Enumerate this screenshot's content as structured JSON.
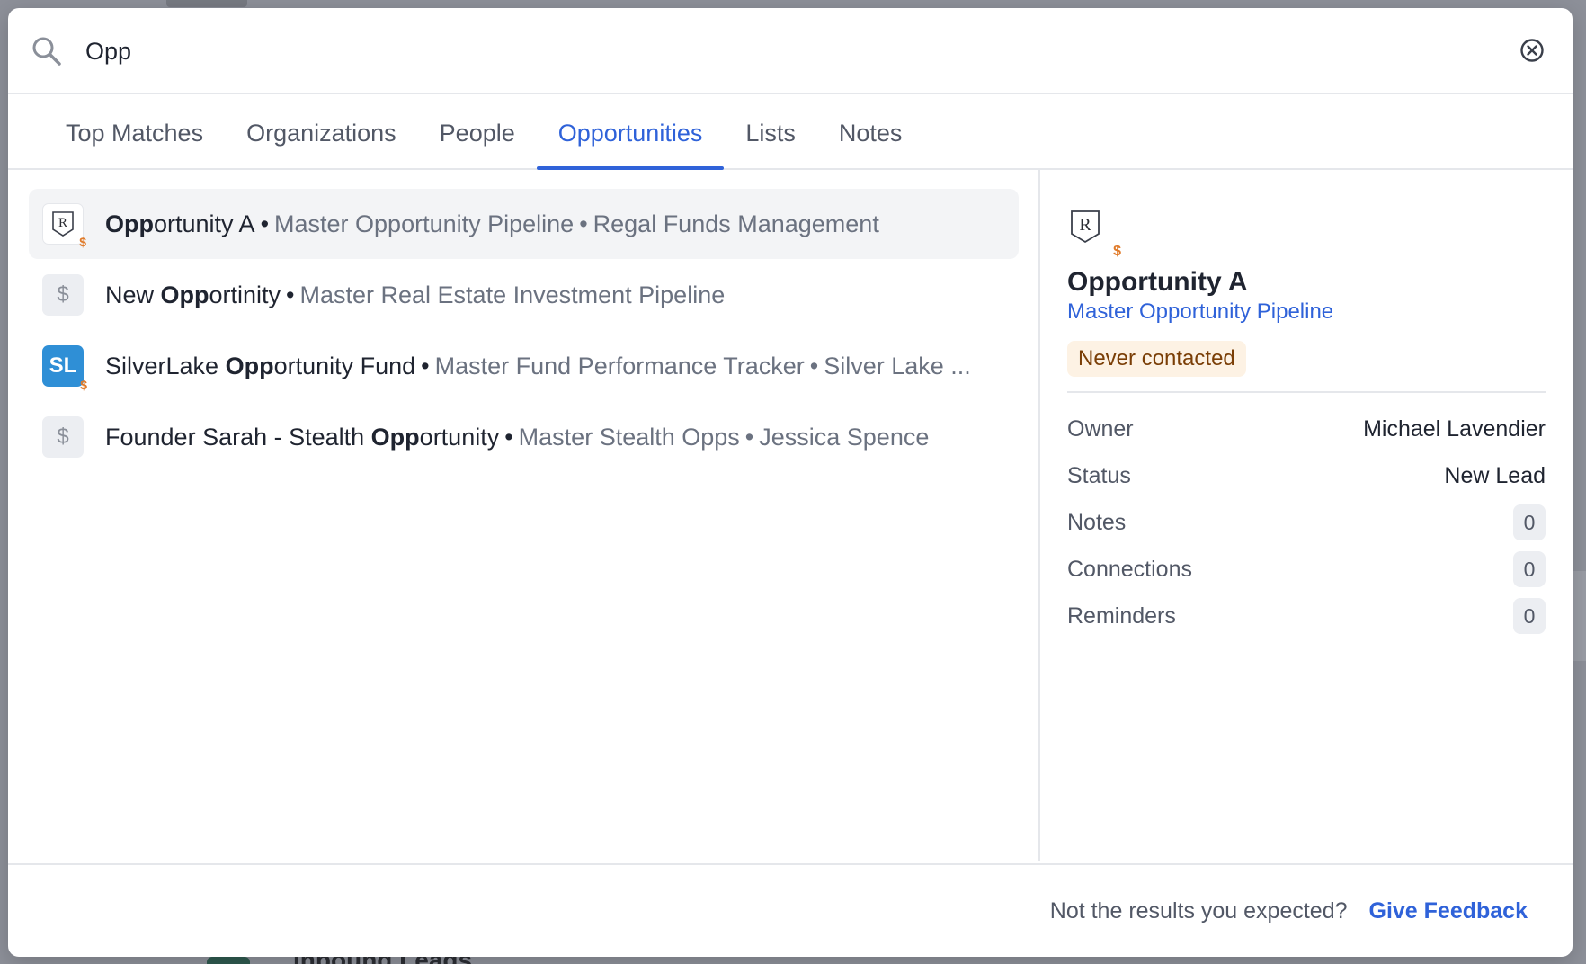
{
  "search": {
    "query": "Opp"
  },
  "tabs": [
    {
      "label": "Top Matches",
      "active": false
    },
    {
      "label": "Organizations",
      "active": false
    },
    {
      "label": "People",
      "active": false
    },
    {
      "label": "Opportunities",
      "active": true
    },
    {
      "label": "Lists",
      "active": false
    },
    {
      "label": "Notes",
      "active": false
    }
  ],
  "results": [
    {
      "icon": "regal-logo-icon",
      "name_pre": "",
      "name_match": "Opp",
      "name_post": "ortunity A",
      "pipeline": "Master Opportunity Pipeline",
      "org": "Regal Funds Management",
      "selected": true
    },
    {
      "icon": "dollar-icon",
      "name_pre": "New ",
      "name_match": "Opp",
      "name_post": "ortinity",
      "pipeline": "Master Real Estate Investment Pipeline",
      "org": "",
      "selected": false
    },
    {
      "icon": "silverlake-logo-icon",
      "icon_text": "SL",
      "name_pre": "SilverLake ",
      "name_match": "Opp",
      "name_post": "ortunity Fund",
      "pipeline": "Master Fund Performance Tracker",
      "org": "Silver Lake ...",
      "selected": false
    },
    {
      "icon": "dollar-icon",
      "name_pre": "Founder Sarah - Stealth ",
      "name_match": "Opp",
      "name_post": "ortunity",
      "pipeline": "Master Stealth Opps",
      "org": "Jessica Spence",
      "selected": false
    }
  ],
  "preview": {
    "title": "Opportunity A",
    "pipeline": "Master Opportunity Pipeline",
    "badge": "Never contacted",
    "properties": [
      {
        "label": "Owner",
        "value": "Michael Lavendier"
      },
      {
        "label": "Status",
        "value": "New Lead"
      }
    ],
    "counts": [
      {
        "label": "Notes",
        "value": "0"
      },
      {
        "label": "Connections",
        "value": "0"
      },
      {
        "label": "Reminders",
        "value": "0"
      }
    ]
  },
  "footer": {
    "prompt": "Not the results you expected?",
    "link": "Give Feedback"
  },
  "background": {
    "peek_text": "Inbound Leads"
  },
  "colors": {
    "accent": "#2f62d9",
    "badge_bg": "#fdf2e4",
    "badge_text": "#7a3e06",
    "dollar_orange": "#e07b2a",
    "silverlake_blue": "#2f8fd6"
  }
}
